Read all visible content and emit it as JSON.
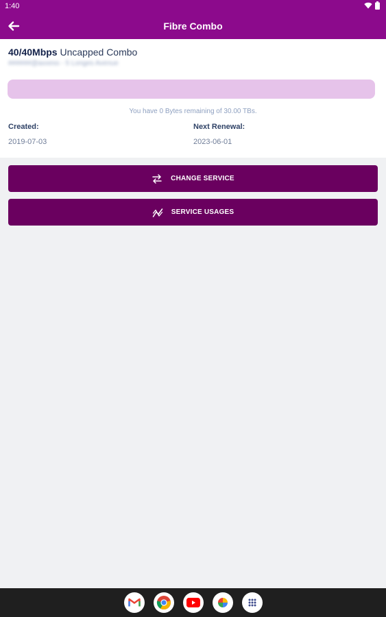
{
  "status_bar": {
    "time": "1:40"
  },
  "app_bar": {
    "title": "Fibre Combo"
  },
  "service": {
    "speed": "40/40Mbps",
    "plan_name": "Uncapped Combo",
    "account_line": "######@axxess - 5 Longes Avenue",
    "usage_fraction": 0,
    "remaining_text": "You have 0 Bytes remaining of 30.00 TBs.",
    "created_label": "Created:",
    "created_value": "2019-07-03",
    "renewal_label": "Next Renewal:",
    "renewal_value": "2023-06-01"
  },
  "actions": {
    "change_service": "CHANGE SERVICE",
    "service_usages": "SERVICE USAGES"
  },
  "dock_apps": [
    "gmail-icon",
    "chrome-icon",
    "youtube-icon",
    "photos-icon",
    "app-drawer-icon"
  ],
  "colors": {
    "primary": "#8c0a8c",
    "button": "#6a005f",
    "bar_track": "#e6c3ea"
  }
}
